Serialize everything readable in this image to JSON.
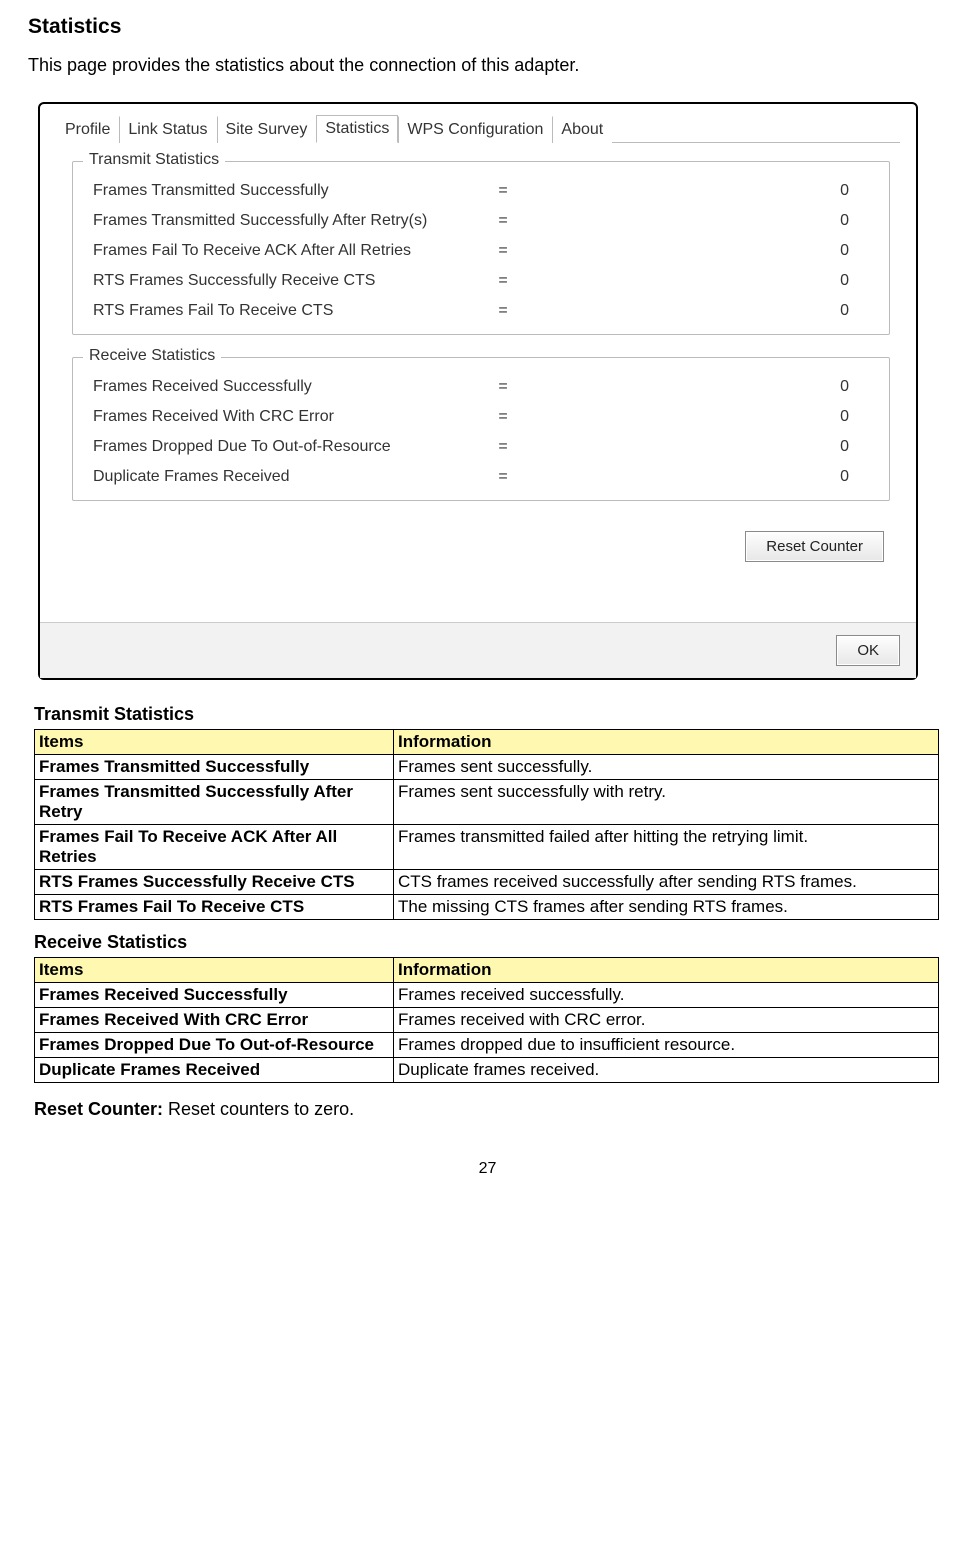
{
  "heading": "Statistics",
  "intro": "This page provides the statistics about the connection of this adapter.",
  "tabs": [
    "Profile",
    "Link Status",
    "Site Survey",
    "Statistics",
    "WPS Configuration",
    "About"
  ],
  "active_tab_index": 3,
  "transmit": {
    "title": "Transmit Statistics",
    "rows": [
      {
        "label": "Frames Transmitted Successfully",
        "eq": "=",
        "value": "0"
      },
      {
        "label": "Frames Transmitted Successfully After Retry(s)",
        "eq": "=",
        "value": "0"
      },
      {
        "label": "Frames Fail To Receive ACK After All Retries",
        "eq": "=",
        "value": "0"
      },
      {
        "label": "RTS Frames Successfully Receive CTS",
        "eq": "=",
        "value": "0"
      },
      {
        "label": "RTS Frames Fail To Receive CTS",
        "eq": "=",
        "value": "0"
      }
    ]
  },
  "receive": {
    "title": "Receive Statistics",
    "rows": [
      {
        "label": "Frames Received Successfully",
        "eq": "=",
        "value": "0"
      },
      {
        "label": "Frames Received With CRC Error",
        "eq": "=",
        "value": "0"
      },
      {
        "label": "Frames Dropped Due To Out-of-Resource",
        "eq": "=",
        "value": "0"
      },
      {
        "label": "Duplicate Frames Received",
        "eq": "=",
        "value": "0"
      }
    ]
  },
  "buttons": {
    "reset_counter": "Reset Counter",
    "ok": "OK"
  },
  "tables": {
    "transmit": {
      "title": "Transmit Statistics",
      "header": {
        "items": "Items",
        "info": "Information"
      },
      "rows": [
        {
          "item": "Frames Transmitted Successfully",
          "info": "Frames sent successfully."
        },
        {
          "item": "Frames Transmitted Successfully After Retry",
          "info": "Frames sent successfully with retry."
        },
        {
          "item": "Frames Fail To Receive ACK After All Retries",
          "info": "Frames transmitted failed after hitting the retrying limit."
        },
        {
          "item": "RTS Frames Successfully Receive CTS",
          "info": "CTS frames received successfully after sending RTS frames."
        },
        {
          "item": "RTS Frames Fail To Receive CTS",
          "info": "The missing CTS frames after sending RTS frames."
        }
      ]
    },
    "receive": {
      "title": "Receive Statistics",
      "header": {
        "items": "Items",
        "info": "Information"
      },
      "rows": [
        {
          "item": "Frames Received Successfully",
          "info": "Frames received successfully."
        },
        {
          "item": "Frames Received With CRC Error",
          "info": "Frames received with CRC error."
        },
        {
          "item": "Frames Dropped Due To Out-of-Resource",
          "info": "Frames dropped due to insufficient resource."
        },
        {
          "item": "Duplicate Frames Received",
          "info": "Duplicate frames received."
        }
      ]
    }
  },
  "reset_note": {
    "label": "Reset Counter:",
    "text": " Reset counters to zero."
  },
  "page_number": "27"
}
